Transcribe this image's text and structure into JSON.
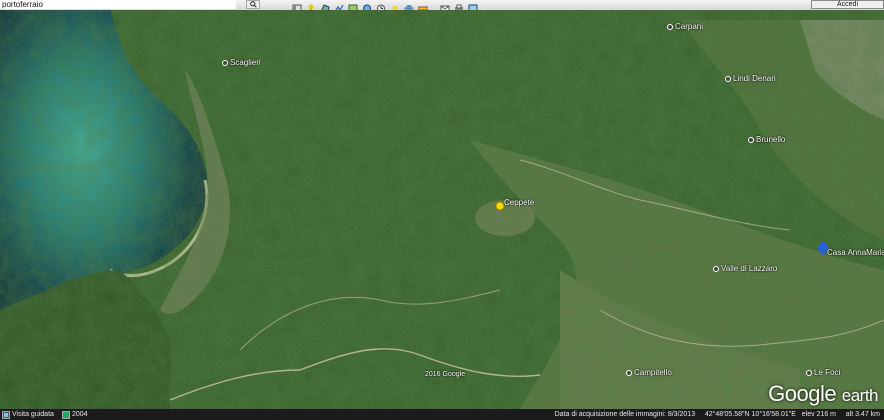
{
  "search": {
    "value": "portoferraio",
    "button_icon": "search-icon"
  },
  "toolbar": {
    "login_label": "Accedi"
  },
  "map": {
    "places": [
      {
        "id": "scaglieri",
        "label": "Scaglieri"
      },
      {
        "id": "ceppete",
        "label": "Ceppete"
      },
      {
        "id": "carpani",
        "label": "Carpani"
      },
      {
        "id": "lindi-denari",
        "label": "Lindi Denari"
      },
      {
        "id": "brunello",
        "label": "Brunello"
      },
      {
        "id": "casa-annamaria",
        "label": "Casa AnnaMaria"
      },
      {
        "id": "valle-di-lazzaro",
        "label": "Valle di Lazzaro"
      },
      {
        "id": "campitello",
        "label": "Campitello"
      },
      {
        "id": "le-foci",
        "label": "Le Foci"
      },
      {
        "id": "copyright",
        "label": "2016 Google"
      }
    ],
    "logo": {
      "main": "Google",
      "suffix": "earth"
    }
  },
  "status": {
    "tour_label": "Visita guidata",
    "year": "2004",
    "date": "Data di acquisizione delle immagini: 8/3/2013",
    "coords": "42°48'05.58\"N  10°16'58.01\"E",
    "elev": "elev  216 m",
    "alt": "alt  3.47 km"
  }
}
